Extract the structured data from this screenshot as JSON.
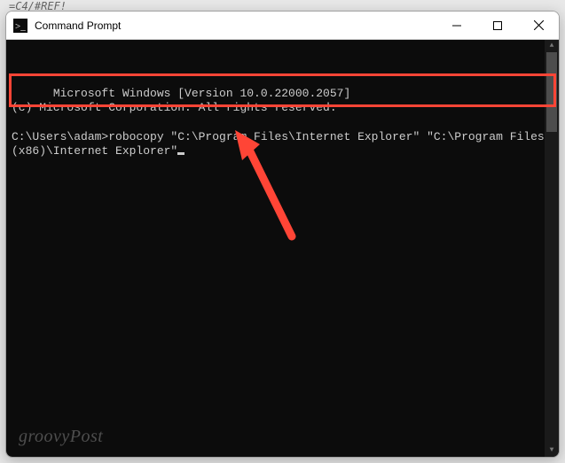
{
  "background_fragment": "=C4/#REF!",
  "window": {
    "title": "Command Prompt"
  },
  "terminal": {
    "line1": "Microsoft Windows [Version 10.0.22000.2057]",
    "line2": "(c) Microsoft Corporation. All rights reserved.",
    "blank": "",
    "prompt": "C:\\Users\\adam>",
    "command": "robocopy \"C:\\Program Files\\Internet Explorer\" \"C:\\Program Files (x86)\\Internet Explorer\""
  },
  "watermark": "groovyPost",
  "colors": {
    "highlight": "#ff4536",
    "terminal_bg": "#0c0c0c",
    "terminal_fg": "#cccccc"
  }
}
